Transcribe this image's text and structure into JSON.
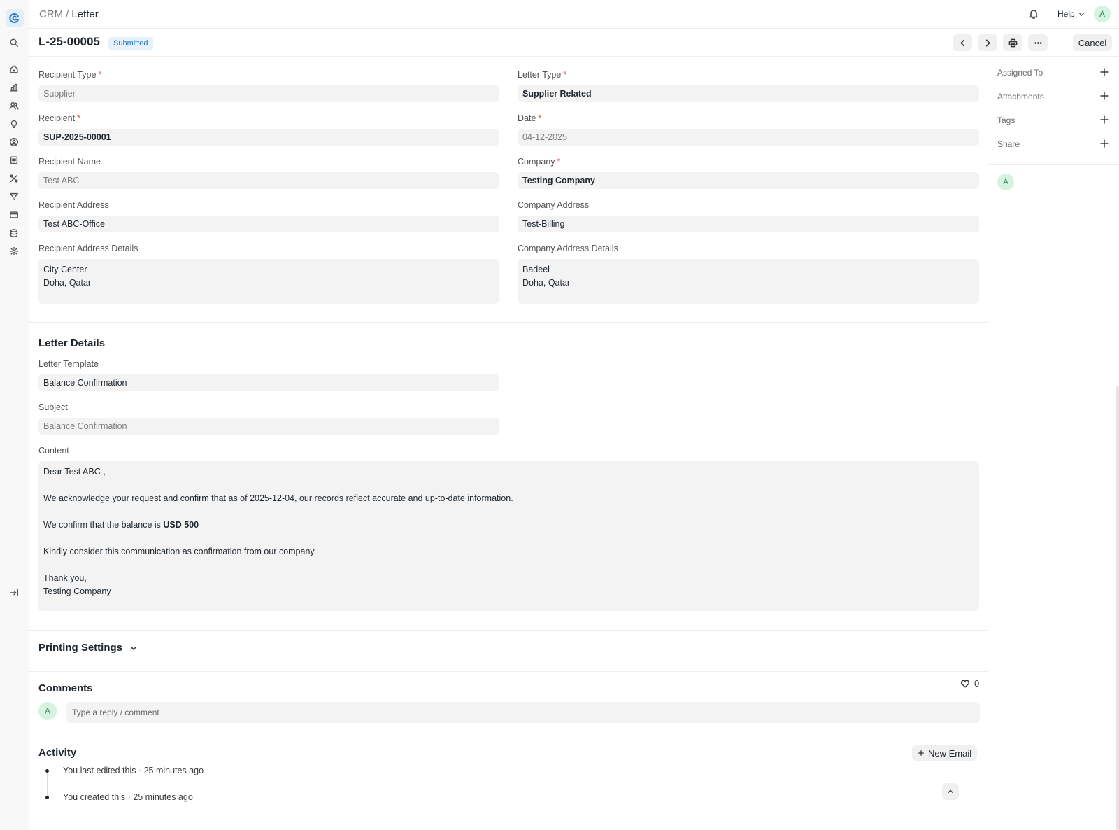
{
  "breadcrumb": {
    "root": "CRM",
    "separator": "/",
    "current": "Letter"
  },
  "topbar": {
    "help_label": "Help",
    "user_initial": "A"
  },
  "document": {
    "title": "L-25-00005",
    "status": "Submitted",
    "cancel_label": "Cancel"
  },
  "fields": {
    "recipient_type": {
      "label": "Recipient Type",
      "value": "Supplier"
    },
    "letter_type": {
      "label": "Letter Type",
      "value": "Supplier Related"
    },
    "recipient": {
      "label": "Recipient",
      "value": "SUP-2025-00001"
    },
    "date": {
      "label": "Date",
      "value": "04-12-2025"
    },
    "recipient_name": {
      "label": "Recipient Name",
      "value": "Test ABC"
    },
    "company": {
      "label": "Company",
      "value": "Testing Company"
    },
    "recipient_address": {
      "label": "Recipient Address",
      "value": "Test ABC-Office"
    },
    "company_address": {
      "label": "Company Address",
      "value": "Test-Billing"
    },
    "recipient_address_details": {
      "label": "Recipient Address Details",
      "line1": "City Center",
      "line2": "Doha, Qatar"
    },
    "company_address_details": {
      "label": "Company Address Details",
      "line1": "Badeel",
      "line2": "Doha, Qatar"
    },
    "required_mark": "*"
  },
  "letter_details": {
    "section_title": "Letter Details",
    "template": {
      "label": "Letter Template",
      "value": "Balance Confirmation"
    },
    "subject": {
      "label": "Subject",
      "value": "Balance Confirmation"
    },
    "content": {
      "label": "Content",
      "greeting": "Dear Test ABC ,",
      "para1": "We acknowledge your request and confirm that as of  2025-12-04, our records reflect accurate and up-to-date information.",
      "para2_prefix": "We confirm that the balance is ",
      "para2_amount": "USD 500",
      "para3": "Kindly consider this communication as confirmation from our company.",
      "closing": "Thank you,",
      "signature": "Testing Company"
    }
  },
  "printing_settings": {
    "title": "Printing Settings"
  },
  "comments": {
    "title": "Comments",
    "like_count": "0",
    "avatar_initial": "A",
    "placeholder": "Type a reply / comment"
  },
  "activity": {
    "title": "Activity",
    "new_email_label": "New Email",
    "items": [
      {
        "text": "You last edited this · 25 minutes ago"
      },
      {
        "text": "You created this · 25 minutes ago"
      }
    ]
  },
  "sidebar": {
    "items": [
      {
        "label": "Assigned To"
      },
      {
        "label": "Attachments"
      },
      {
        "label": "Tags"
      },
      {
        "label": "Share"
      }
    ],
    "viewer_initial": "A"
  },
  "icons": {
    "rail": [
      "app-logo-icon",
      "search-icon",
      "home-icon",
      "chart-icon",
      "users-icon",
      "bulb-icon",
      "contact-icon",
      "notes-icon",
      "tools-icon",
      "filter-icon",
      "card-icon",
      "database-icon",
      "gear-icon",
      "collapse-sidebar-icon"
    ]
  },
  "colors": {
    "status_badge_bg": "#e6f1fb",
    "status_badge_text": "#2a78c7",
    "avatar_bg": "#d6f2e1",
    "avatar_text": "#2a8a58",
    "required": "#e24c4c"
  }
}
